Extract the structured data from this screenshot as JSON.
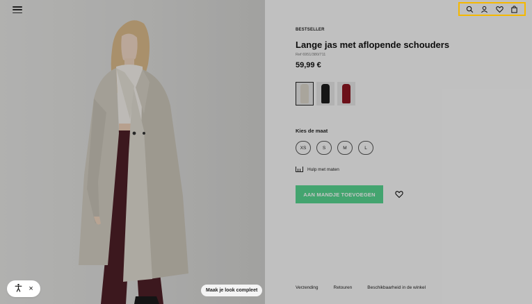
{
  "header": {
    "icons": [
      "search-icon",
      "user-icon",
      "heart-icon",
      "bag-icon"
    ],
    "highlight_color": "#f5b800"
  },
  "left_panel": {
    "menu_icon": "hamburger-icon",
    "accessibility": {
      "icon": "accessibility-icon",
      "close_label": "×"
    },
    "complete_look_label": "Maak je look compleet"
  },
  "product": {
    "badge": "BESTSELLER",
    "title": "Lange jas met aflopende schouders",
    "ref": "Ref 6951/380/711",
    "price": "59,99 €",
    "colors": [
      {
        "name": "ecru",
        "hex": "#d9d4c8",
        "selected": true
      },
      {
        "name": "black",
        "hex": "#1c1c1c",
        "selected": false
      },
      {
        "name": "red",
        "hex": "#8b1520",
        "selected": false
      }
    ],
    "size_label": "Kies de maat",
    "sizes": [
      "XS",
      "S",
      "M",
      "L"
    ],
    "size_help_label": "Hulp met maten",
    "add_to_cart_label": "AAN MANDJE TOEVOEGEN",
    "accent_color": "#56d38f"
  },
  "footer": {
    "links": [
      "Verzending",
      "Retouren",
      "Beschikbaarheid in de winkel"
    ]
  }
}
